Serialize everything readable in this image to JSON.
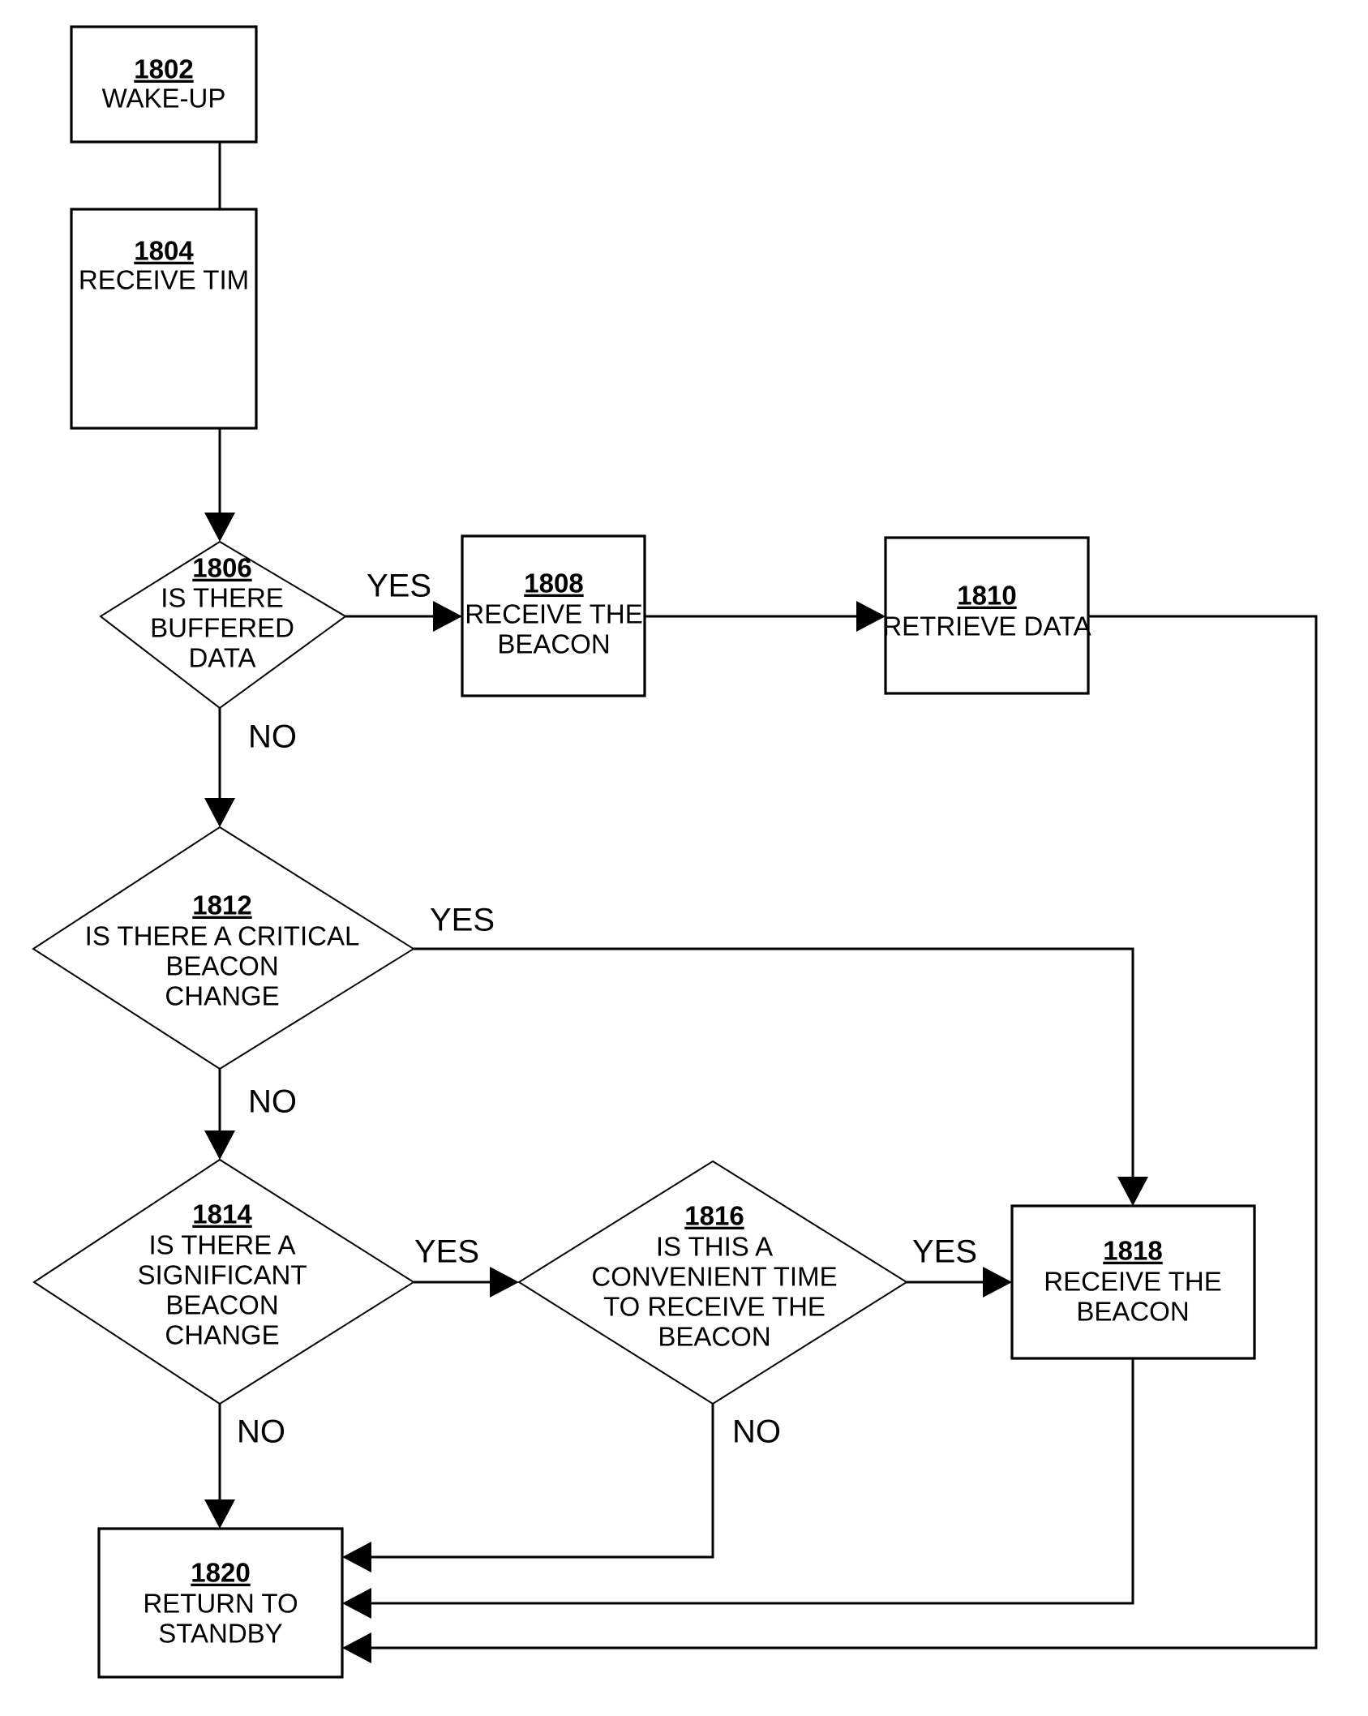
{
  "figure": {
    "kind": "patent-flowchart",
    "background_color": "#ffffff",
    "line_color": "#000000",
    "text_color": "#000000"
  },
  "nodes": {
    "n1802": {
      "ref": "1802",
      "lines": [
        "WAKE-UP"
      ],
      "shape": "process"
    },
    "n1804": {
      "ref": "1804",
      "lines": [
        "RECEIVE TIM"
      ],
      "shape": "process"
    },
    "n1806": {
      "ref": "1806",
      "lines": [
        "IS THERE",
        "BUFFERED",
        "DATA"
      ],
      "shape": "decision"
    },
    "n1808": {
      "ref": "1808",
      "lines": [
        "RECEIVE THE",
        "BEACON"
      ],
      "shape": "process"
    },
    "n1810": {
      "ref": "1810",
      "lines": [
        "RETRIEVE DATA"
      ],
      "shape": "process"
    },
    "n1812": {
      "ref": "1812",
      "lines": [
        "IS THERE A CRITICAL",
        "BEACON",
        "CHANGE"
      ],
      "shape": "decision"
    },
    "n1814": {
      "ref": "1814",
      "lines": [
        "IS THERE A",
        "SIGNIFICANT",
        "BEACON",
        "CHANGE"
      ],
      "shape": "decision"
    },
    "n1816": {
      "ref": "1816",
      "lines": [
        "IS THIS A",
        "CONVENIENT TIME",
        "TO RECEIVE THE",
        "BEACON"
      ],
      "shape": "decision"
    },
    "n1818": {
      "ref": "1818",
      "lines": [
        "RECEIVE THE",
        "BEACON"
      ],
      "shape": "process"
    },
    "n1820": {
      "ref": "1820",
      "lines": [
        "RETURN TO",
        "STANDBY"
      ],
      "shape": "process"
    }
  },
  "edge_labels": {
    "e1806_yes": "YES",
    "e1806_no": "NO",
    "e1812_yes": "YES",
    "e1812_no": "NO",
    "e1814_yes": "YES",
    "e1814_no": "NO",
    "e1816_yes": "YES",
    "e1816_no": "NO"
  }
}
